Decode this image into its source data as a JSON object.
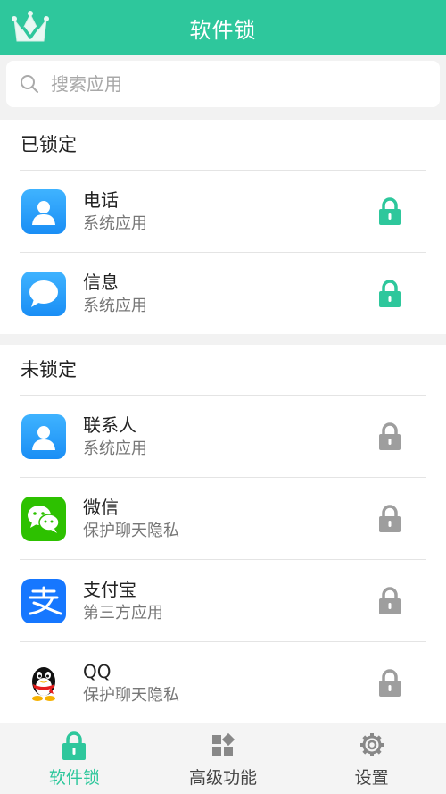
{
  "header": {
    "title": "软件锁",
    "logo_icon": "crown-v-icon"
  },
  "search": {
    "placeholder": "搜索应用"
  },
  "locked": {
    "title": "已锁定",
    "items": [
      {
        "name": "电话",
        "sub": "系统应用",
        "icon": "contact-icon",
        "locked": true
      },
      {
        "name": "信息",
        "sub": "系统应用",
        "icon": "message-icon",
        "locked": true
      }
    ]
  },
  "unlocked": {
    "title": "未锁定",
    "items": [
      {
        "name": "联系人",
        "sub": "系统应用",
        "icon": "contact-icon",
        "locked": false
      },
      {
        "name": "微信",
        "sub": "保护聊天隐私",
        "icon": "wechat-icon",
        "locked": false
      },
      {
        "name": "支付宝",
        "sub": "第三方应用",
        "icon": "alipay-icon",
        "locked": false
      },
      {
        "name": "QQ",
        "sub": "保护聊天隐私",
        "icon": "qq-icon",
        "locked": false
      }
    ]
  },
  "tabbar": {
    "items": [
      {
        "label": "软件锁",
        "icon": "lock-icon",
        "active": true
      },
      {
        "label": "高级功能",
        "icon": "grid-icon",
        "active": false
      },
      {
        "label": "设置",
        "icon": "gear-icon",
        "active": false
      }
    ]
  },
  "colors": {
    "accent": "#2ec79c",
    "lock_inactive": "#9e9e9e"
  }
}
